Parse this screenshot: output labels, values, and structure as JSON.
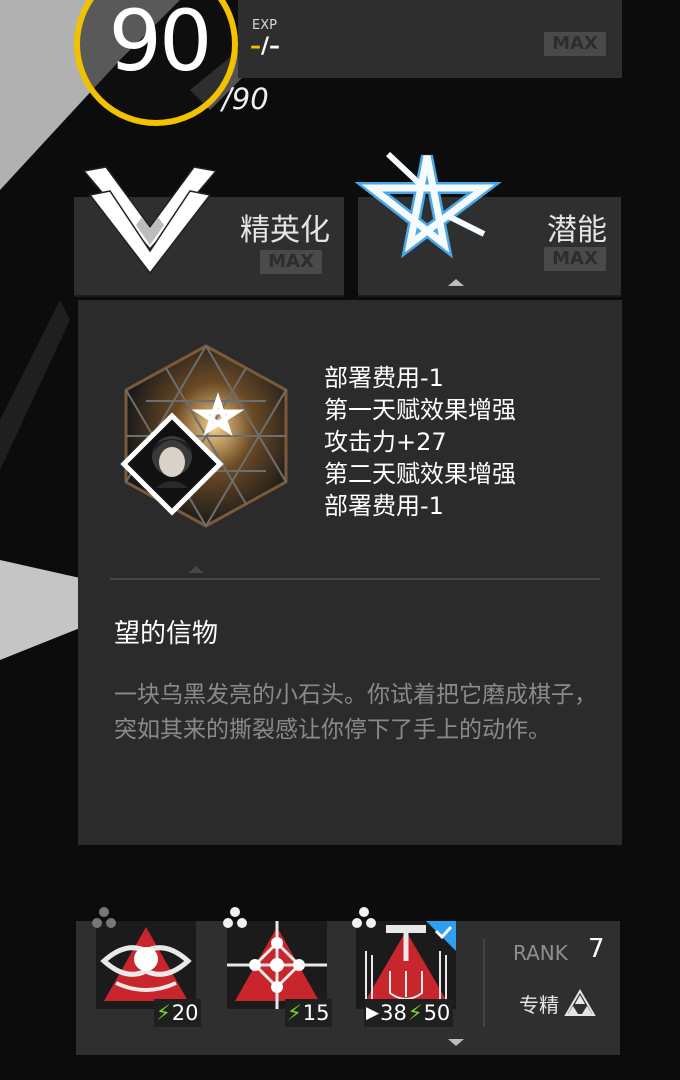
{
  "level": {
    "current": "90",
    "max": "/90"
  },
  "exp": {
    "label": "EXP",
    "value_dash": "–",
    "value_rest": "/–",
    "max_badge": "MAX"
  },
  "elite": {
    "label": "精英化",
    "max_badge": "MAX",
    "icon": "elite-chevrons-icon"
  },
  "potential": {
    "label": "潜能",
    "max_badge": "MAX",
    "icon": "potential-star-icon"
  },
  "token": {
    "bonuses": [
      "部署费用-1",
      "第一天赋效果增强",
      "攻击力+27",
      "第二天赋效果增强",
      "部署费用-1"
    ],
    "name": "望的信物",
    "description": "一块乌黑发亮的小石头。你试着把它磨成棋子，突如其来的撕裂感让你停下了手上的动作。"
  },
  "skills": [
    {
      "sp_cost": "20",
      "icon": "skill-1-icon"
    },
    {
      "sp_cost": "15",
      "icon": "skill-2-icon"
    },
    {
      "initial_sp": "38",
      "sp_cost": "50",
      "icon": "skill-3-icon",
      "selected": true
    }
  ],
  "rank": {
    "label": "RANK",
    "value": "7",
    "spec_label": "专精"
  },
  "colors": {
    "accent": "#f2c200",
    "sp_green": "#7ad12c",
    "skill_red": "#c9252c",
    "select_blue": "#2c9ff0"
  }
}
